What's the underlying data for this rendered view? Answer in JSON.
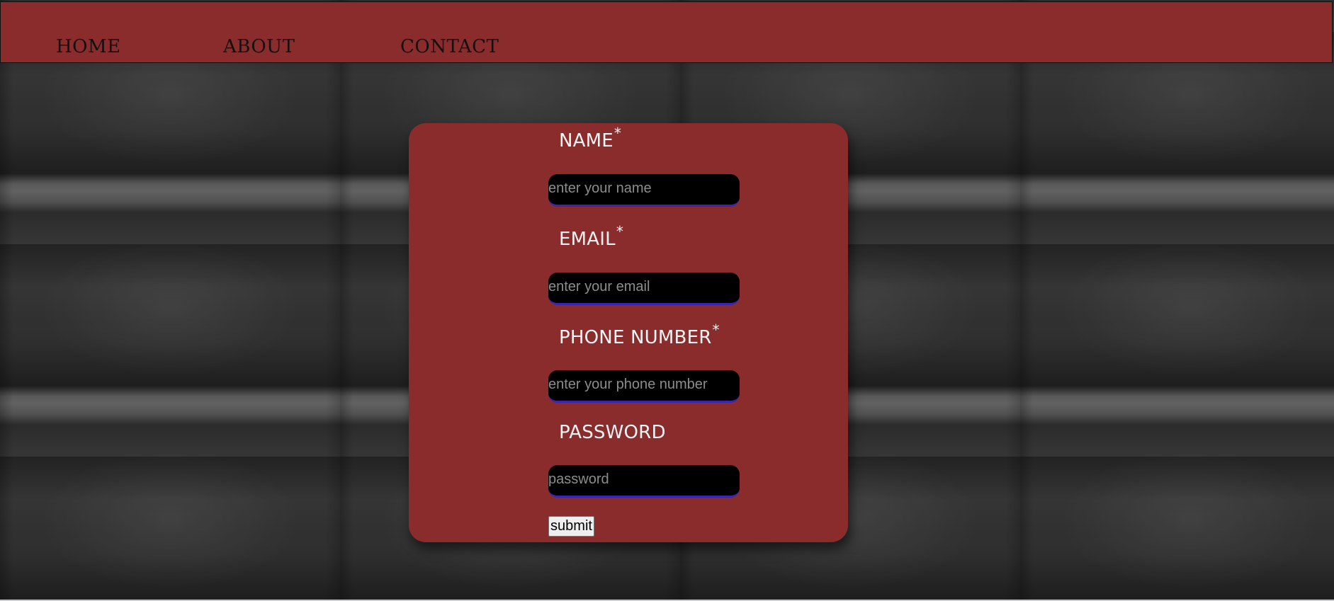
{
  "nav": {
    "items": [
      {
        "label": "HOME"
      },
      {
        "label": "ABOUT"
      },
      {
        "label": "CONTACT"
      }
    ]
  },
  "form": {
    "fields": [
      {
        "label": "NAME",
        "required_mark": "*",
        "placeholder": "enter your name",
        "value": ""
      },
      {
        "label": "EMAIL",
        "required_mark": "*",
        "placeholder": "enter your email",
        "value": ""
      },
      {
        "label": "PHONE NUMBER",
        "required_mark": "*",
        "placeholder": "enter your phone number",
        "value": ""
      },
      {
        "label": "PASSWORD",
        "placeholder": "password",
        "value": ""
      }
    ],
    "submit_label": "submit"
  },
  "colors": {
    "accent": "#8a2b2c",
    "input_background": "#000000",
    "input_underline": "#3a25b0",
    "label_text": "#f4f4f4"
  }
}
